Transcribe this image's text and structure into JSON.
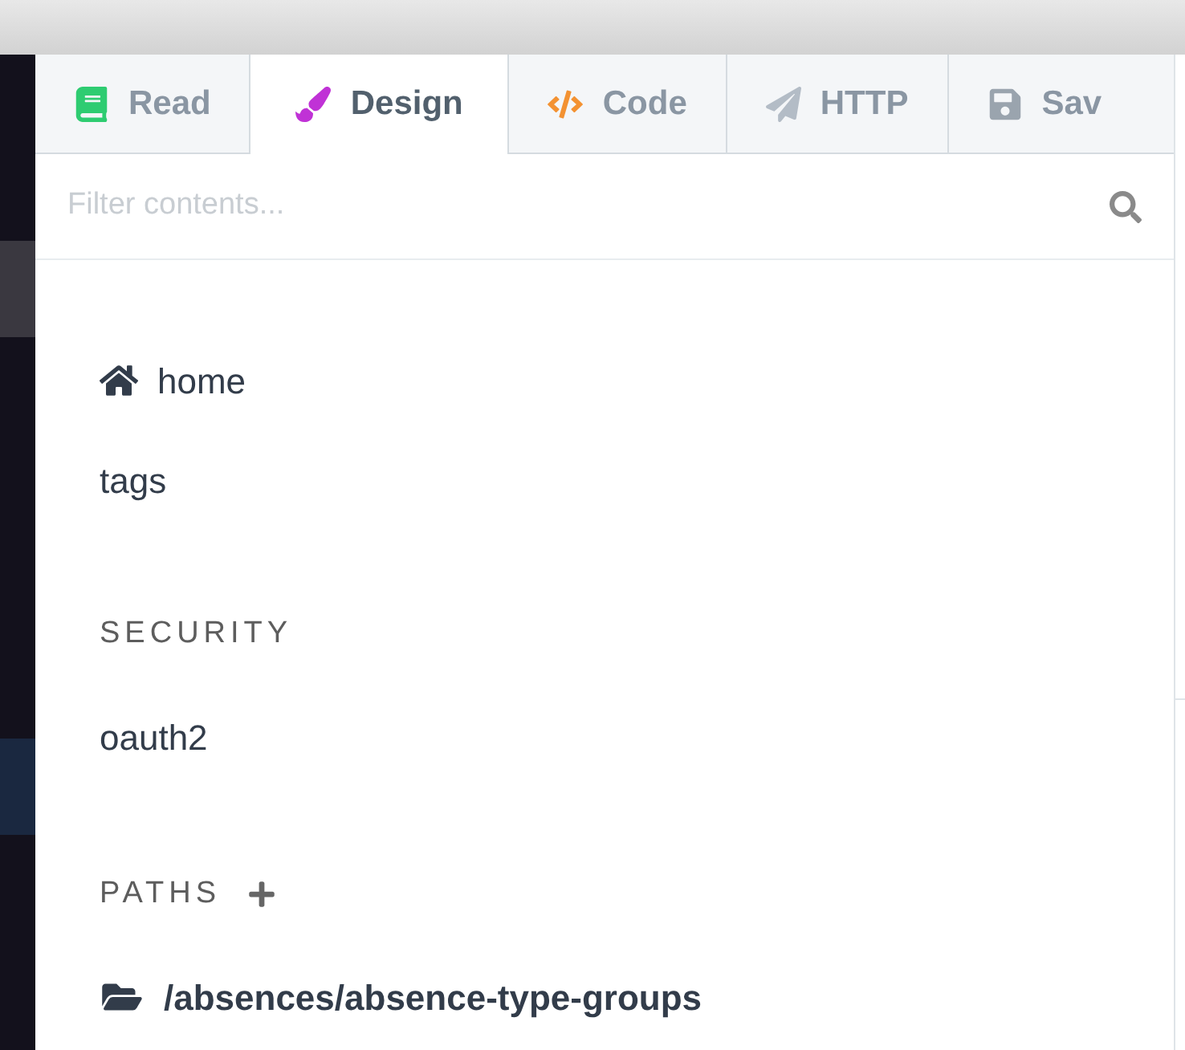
{
  "tabs": [
    {
      "label": "Read",
      "kind": "book",
      "selected": false
    },
    {
      "label": "Design",
      "kind": "brush",
      "selected": true
    },
    {
      "label": "Code",
      "kind": "code",
      "selected": false
    },
    {
      "label": "HTTP",
      "kind": "send",
      "selected": false
    },
    {
      "label": "Sav",
      "kind": "save",
      "selected": false
    }
  ],
  "search": {
    "placeholder": "Filter contents..."
  },
  "nav": [
    {
      "label": "home",
      "kind": "home"
    },
    {
      "label": "tags",
      "kind": "plain"
    }
  ],
  "sections": [
    {
      "title": "SECURITY",
      "add": false,
      "items": [
        {
          "label": "oauth2",
          "kind": "plain"
        }
      ]
    },
    {
      "title": "PATHS",
      "add": true,
      "items": [
        {
          "label": "/absences/absence-type-groups",
          "kind": "folder"
        }
      ]
    }
  ]
}
